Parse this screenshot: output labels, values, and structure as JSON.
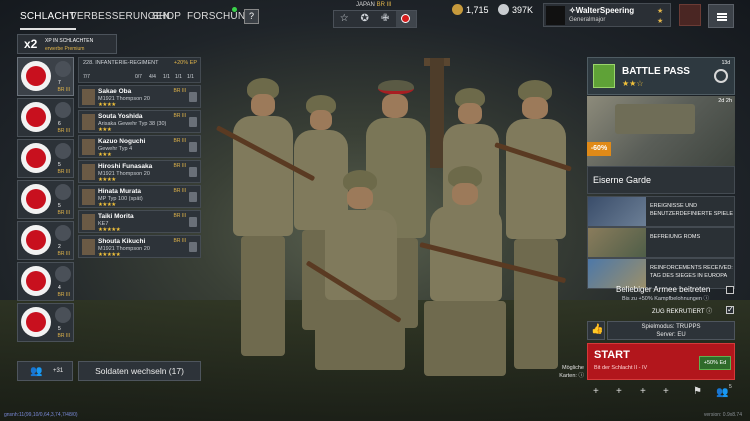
{
  "nav": {
    "tabs": [
      {
        "label": "SCHLACHT",
        "active": true
      },
      {
        "label": "VERBESSERUNGEN",
        "active": false
      },
      {
        "label": "SHOP",
        "active": false
      },
      {
        "label": "FORSCHUNG",
        "active": false
      }
    ],
    "help_label": "?",
    "army_label": "JAPAN",
    "army_br": "BR III",
    "modes": [
      "☆",
      "✪",
      "✙",
      "●"
    ],
    "silver": "1,715",
    "gold": "397K",
    "player_name": "✧WalterSpeering",
    "player_rank": "Generalmajor"
  },
  "xp": {
    "multiplier": "x2",
    "line1": "XP IN SCHLACHTEN",
    "line2": "erwerbe Premium"
  },
  "squads": [
    {
      "count": "7",
      "br": "BR III"
    },
    {
      "count": "6",
      "br": "BR III"
    },
    {
      "count": "5",
      "br": "BR III"
    },
    {
      "count": "5",
      "br": "BR III"
    },
    {
      "count": "2",
      "br": "BR III"
    },
    {
      "count": "4",
      "br": "BR III"
    },
    {
      "count": "5",
      "br": "BR III"
    }
  ],
  "roster": {
    "regiment": "228. INFANTERIE-REGIMENT",
    "bonus": "+20% EP",
    "stats": [
      "7/7",
      "0/7",
      "4/4",
      "1/1",
      "1/1",
      "1/1"
    ],
    "soldiers": [
      {
        "name": "Sakae Oba",
        "weapon": "M1921 Thompson 20",
        "stars": "★★★★",
        "br": "BR III"
      },
      {
        "name": "Souta Yoshida",
        "weapon": "Arisaka Gewehr Typ 38 (30)",
        "stars": "★★★",
        "br": "BR III"
      },
      {
        "name": "Kazuo Noguchi",
        "weapon": "Gewehr Typ 4",
        "stars": "★★★",
        "br": "BR III"
      },
      {
        "name": "Hiroshi Funasaka",
        "weapon": "M1921 Thompson 20",
        "stars": "★★★★",
        "br": "BR III"
      },
      {
        "name": "Hinata Murata",
        "weapon": "MP Typ 100 (spät)",
        "stars": "★★★★",
        "br": "BR III"
      },
      {
        "name": "Taiki Morita",
        "weapon": "KE7",
        "stars": "★★★★★",
        "br": "BR III"
      },
      {
        "name": "Shouta Kikuchi",
        "weapon": "M1921 Thompson 20",
        "stars": "★★★★★",
        "br": "BR III"
      }
    ]
  },
  "bottom_left": {
    "invite_count": "+31",
    "change_soldiers": "Soldaten wechseln (17)"
  },
  "battle_pass": {
    "title": "BATTLE PASS",
    "stars": "★★☆",
    "level": "13d",
    "timer": "2d 2h",
    "discount": "-60%",
    "item_title": "Eiserne Garde"
  },
  "events": [
    {
      "text": "EREIGNISSE UND BENUTZERDEFINIERTE SPIELE"
    },
    {
      "text": "BEFREIUNG ROMS"
    },
    {
      "text": "REINFORCEMENTS RECEIVED: TAG DES SIEGES IN EUROPA"
    }
  ],
  "options": {
    "join_any": "Beliebiger Armee beitreten",
    "join_bonus": "Bis zu +50% Kampfbelohnungen",
    "recruit": "ZUG REKRUTIERT"
  },
  "match": {
    "mode_line": "Spielmodus: TRUPPS",
    "server_line": "Server: EU",
    "maps_label": "Mögliche Karten:",
    "start_label": "START",
    "start_sub": "Bit der Schlacht II - IV",
    "boost": "+50% Ed"
  },
  "bottom_icons": [
    "+",
    "+",
    "+",
    "+",
    "⚑",
    "5"
  ],
  "footer": {
    "left": "gnsnh:11(99,10/0,64,3,74,7/48/0)",
    "right": "version: 0.9x8.74"
  }
}
